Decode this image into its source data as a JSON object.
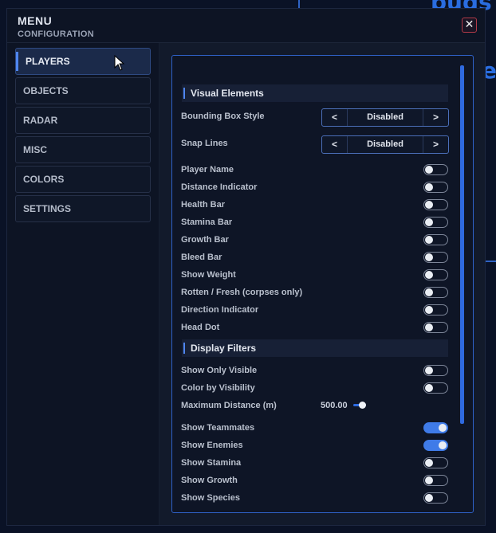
{
  "window": {
    "title": "MENU",
    "subtitle": "CONFIGURATION",
    "close_label": "✕"
  },
  "background": {
    "text_fragment": "buds"
  },
  "sidebar": {
    "items": [
      {
        "label": "PLAYERS",
        "active": true
      },
      {
        "label": "OBJECTS",
        "active": false
      },
      {
        "label": "RADAR",
        "active": false
      },
      {
        "label": "MISC",
        "active": false
      },
      {
        "label": "COLORS",
        "active": false
      },
      {
        "label": "SETTINGS",
        "active": false
      }
    ]
  },
  "panel": {
    "sections": {
      "visual": "Visual Elements",
      "filters": "Display Filters"
    },
    "selectors": [
      {
        "label": "Bounding Box Style",
        "value": "Disabled",
        "prev": "<",
        "next": ">"
      },
      {
        "label": "Snap Lines",
        "value": "Disabled",
        "prev": "<",
        "next": ">"
      }
    ],
    "visual_toggles": [
      {
        "label": "Player Name",
        "on": false
      },
      {
        "label": "Distance Indicator",
        "on": false
      },
      {
        "label": "Health Bar",
        "on": false
      },
      {
        "label": "Stamina Bar",
        "on": false
      },
      {
        "label": "Growth Bar",
        "on": false
      },
      {
        "label": "Bleed Bar",
        "on": false
      },
      {
        "label": "Show Weight",
        "on": false
      },
      {
        "label": "Rotten / Fresh (corpses only)",
        "on": false
      },
      {
        "label": "Direction Indicator",
        "on": false
      },
      {
        "label": "Head Dot",
        "on": false
      }
    ],
    "filter_toggles_top": [
      {
        "label": "Show Only Visible",
        "on": false
      },
      {
        "label": "Color by Visibility",
        "on": false
      }
    ],
    "slider": {
      "label": "Maximum Distance (m)",
      "value": "500.00"
    },
    "filter_toggles_bottom": [
      {
        "label": "Show Teammates",
        "on": true
      },
      {
        "label": "Show Enemies",
        "on": true
      },
      {
        "label": "Show Stamina",
        "on": false
      },
      {
        "label": "Show Growth",
        "on": false
      },
      {
        "label": "Show Species",
        "on": false
      }
    ]
  },
  "colors": {
    "accent": "#3f7be8",
    "danger": "#b23a48",
    "panel_border": "#2f62c9"
  }
}
